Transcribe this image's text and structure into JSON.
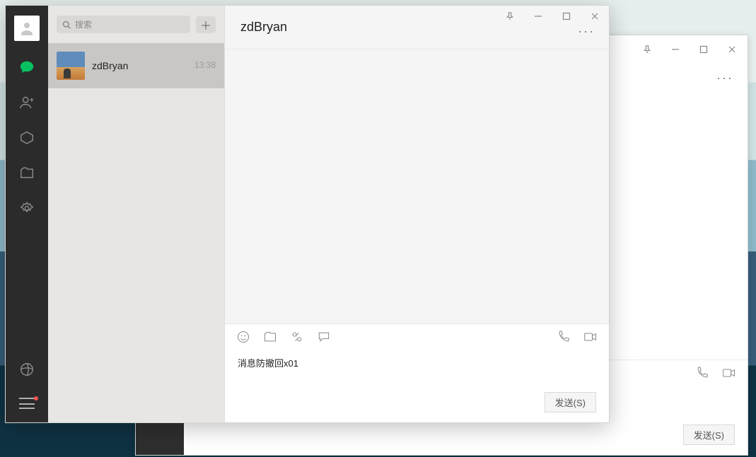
{
  "search_placeholder": "搜索",
  "conversation": {
    "name": "zdBryan",
    "time": "13:38"
  },
  "chat": {
    "title": "zdBryan",
    "input_text": "消息防撤回x01"
  },
  "send_label": "发送(S)"
}
